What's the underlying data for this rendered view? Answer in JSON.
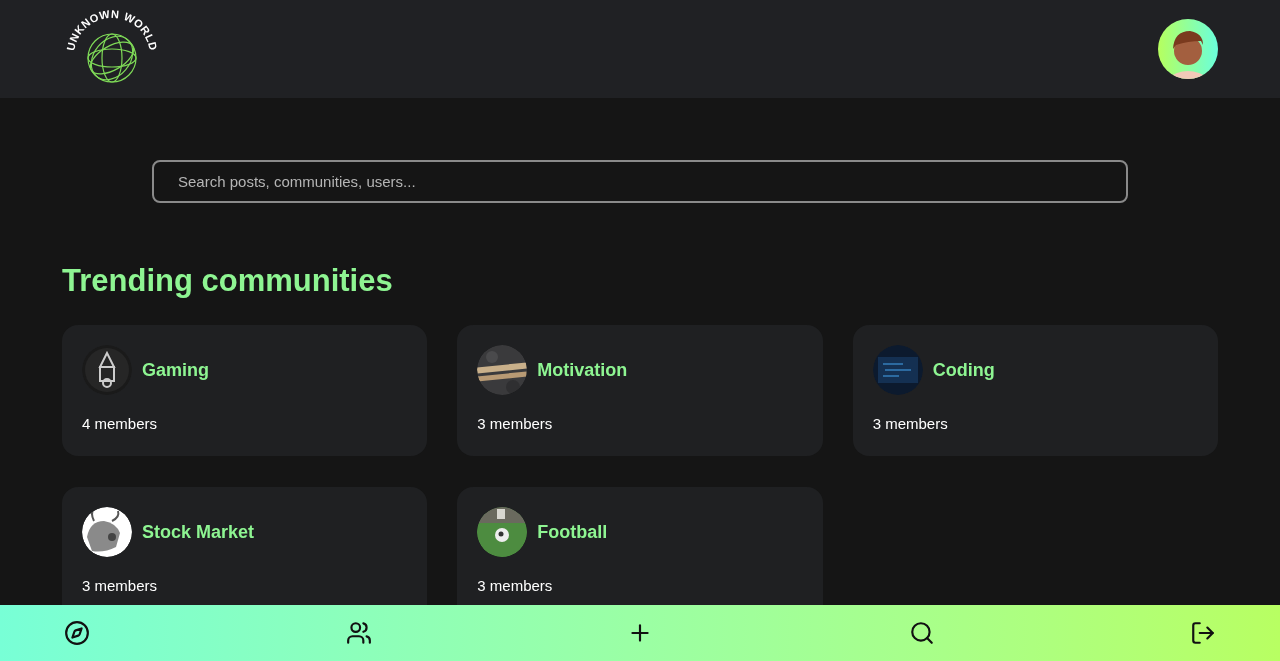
{
  "header": {
    "logo_text": "UNKNOWN WORLD"
  },
  "search": {
    "placeholder": "Search posts, communities, users..."
  },
  "trending": {
    "title": "Trending communities",
    "communities": [
      {
        "name": "Gaming",
        "members": "4 members"
      },
      {
        "name": "Motivation",
        "members": "3 members"
      },
      {
        "name": "Coding",
        "members": "3 members"
      },
      {
        "name": "Stock Market",
        "members": "3 members"
      },
      {
        "name": "Football",
        "members": "3 members"
      }
    ]
  },
  "bottom_nav": [
    {
      "kind": "explore"
    },
    {
      "kind": "communities"
    },
    {
      "kind": "create"
    },
    {
      "kind": "search"
    },
    {
      "kind": "logout"
    }
  ]
}
